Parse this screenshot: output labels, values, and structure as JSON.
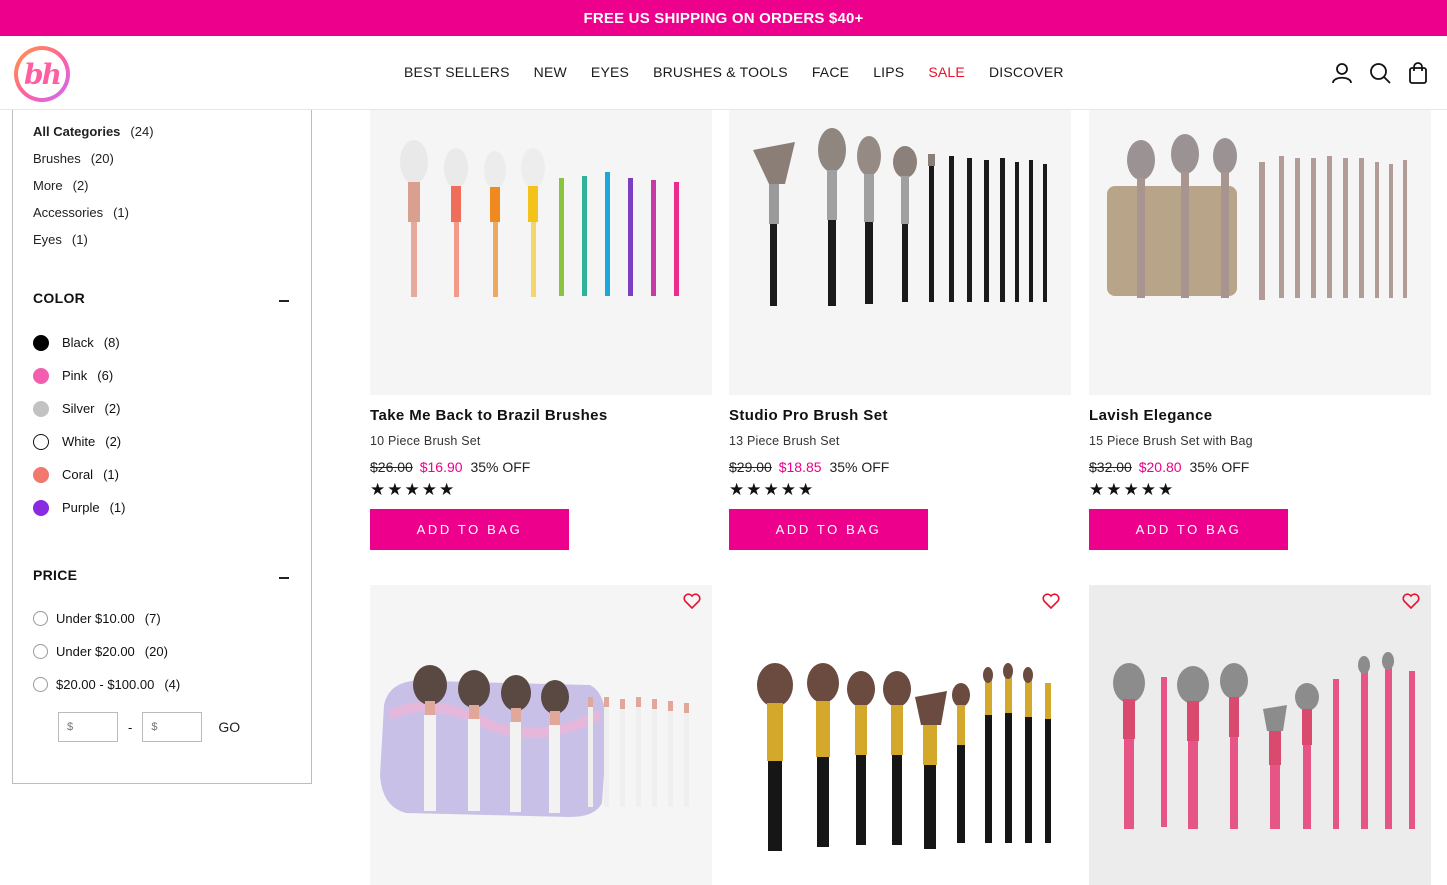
{
  "promo_banner": "FREE US SHIPPING ON ORDERS $40+",
  "logo_text": "bh",
  "nav": [
    {
      "label": "BEST SELLERS"
    },
    {
      "label": "NEW"
    },
    {
      "label": "EYES"
    },
    {
      "label": "BRUSHES & TOOLS"
    },
    {
      "label": "FACE"
    },
    {
      "label": "LIPS"
    },
    {
      "label": "SALE"
    },
    {
      "label": "DISCOVER"
    }
  ],
  "header_icons": [
    "account-icon",
    "search-icon",
    "bag-icon"
  ],
  "categories": [
    {
      "label": "All Categories",
      "count": "(24)"
    },
    {
      "label": "Brushes",
      "count": "(20)"
    },
    {
      "label": "More",
      "count": "(2)"
    },
    {
      "label": "Accessories",
      "count": "(1)"
    },
    {
      "label": "Eyes",
      "count": "(1)"
    }
  ],
  "color_section": {
    "title": "COLOR",
    "items": [
      {
        "label": "Black",
        "count": "(8)",
        "swatch": "#000000"
      },
      {
        "label": "Pink",
        "count": "(6)",
        "swatch": "#f25fae"
      },
      {
        "label": "Silver",
        "count": "(2)",
        "swatch": "#c2c2c2"
      },
      {
        "label": "White",
        "count": "(2)",
        "swatch": "#ffffff"
      },
      {
        "label": "Coral",
        "count": "(1)",
        "swatch": "#f0786c"
      },
      {
        "label": "Purple",
        "count": "(1)",
        "swatch": "#8a2be2"
      }
    ]
  },
  "price_section": {
    "title": "PRICE",
    "items": [
      {
        "label": "Under $10.00",
        "count": "(7)"
      },
      {
        "label": "Under $20.00",
        "count": "(20)"
      },
      {
        "label": "$20.00 - $100.00",
        "count": "(4)"
      }
    ],
    "min_placeholder": "$",
    "max_placeholder": "$",
    "dash": "-",
    "go_label": "GO"
  },
  "products": [
    {
      "name": "Take Me Back to Brazil Brushes",
      "subtitle": "10 Piece Brush Set",
      "old_price": "$26.00",
      "sale_price": "$16.90",
      "discount": "35% OFF",
      "stars": "★★★★★",
      "rating": 5,
      "button": "ADD TO BAG"
    },
    {
      "name": "Studio Pro Brush Set",
      "subtitle": "13 Piece Brush Set",
      "old_price": "$29.00",
      "sale_price": "$18.85",
      "discount": "35% OFF",
      "stars": "★★★★★",
      "rating": 5,
      "button": "ADD TO BAG"
    },
    {
      "name": "Lavish Elegance",
      "subtitle": "15 Piece Brush Set with Bag",
      "old_price": "$32.00",
      "sale_price": "$20.80",
      "discount": "35% OFF",
      "stars": "★★★★★",
      "rating": 5,
      "button": "ADD TO BAG"
    },
    {
      "name": "",
      "subtitle": "",
      "old_price": "",
      "sale_price": "",
      "discount": "",
      "stars": "",
      "button": ""
    },
    {
      "name": "",
      "subtitle": "",
      "old_price": "",
      "sale_price": "",
      "discount": "",
      "stars": "",
      "button": ""
    },
    {
      "name": "",
      "subtitle": "",
      "old_price": "",
      "sale_price": "",
      "discount": "",
      "stars": "",
      "button": ""
    }
  ],
  "colors": {
    "brand_pink": "#ec008c",
    "sale_red": "#e8112d"
  }
}
